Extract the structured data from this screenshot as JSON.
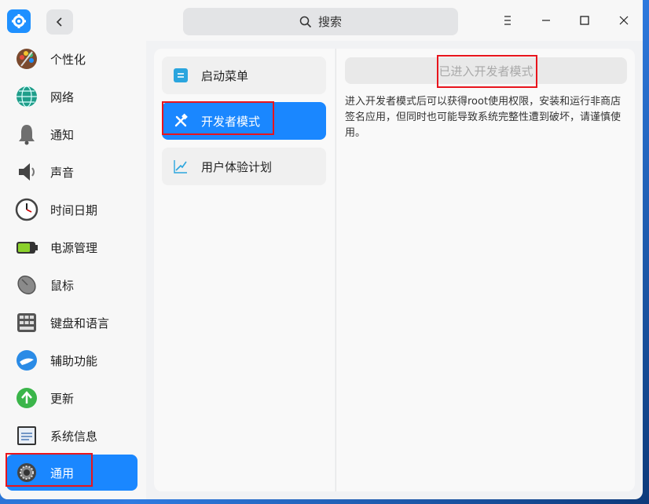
{
  "search": {
    "label": "搜索"
  },
  "sidebar": {
    "items": [
      {
        "label": "个性化",
        "icon": "personalization-icon"
      },
      {
        "label": "网络",
        "icon": "network-icon"
      },
      {
        "label": "通知",
        "icon": "bell-icon"
      },
      {
        "label": "声音",
        "icon": "speaker-icon"
      },
      {
        "label": "时间日期",
        "icon": "clock-icon"
      },
      {
        "label": "电源管理",
        "icon": "battery-icon"
      },
      {
        "label": "鼠标",
        "icon": "mouse-icon"
      },
      {
        "label": "键盘和语言",
        "icon": "keyboard-icon"
      },
      {
        "label": "辅助功能",
        "icon": "accessibility-icon"
      },
      {
        "label": "更新",
        "icon": "update-icon"
      },
      {
        "label": "系统信息",
        "icon": "system-info-icon"
      },
      {
        "label": "通用",
        "icon": "gear-icon",
        "active": true
      }
    ]
  },
  "general": {
    "items": [
      {
        "label": "启动菜单",
        "icon": "boot-menu-icon"
      },
      {
        "label": "开发者模式",
        "icon": "tools-icon",
        "active": true
      },
      {
        "label": "用户体验计划",
        "icon": "chart-trend-icon"
      }
    ]
  },
  "developer": {
    "button_label": "已进入开发者模式",
    "description": "进入开发者模式后可以获得root使用权限，安装和运行非商店签名应用，但同时也可能导致系统完整性遭到破坏，请谨慎使用。"
  },
  "colors": {
    "accent": "#1a87ff",
    "highlight": "#e8141c"
  }
}
